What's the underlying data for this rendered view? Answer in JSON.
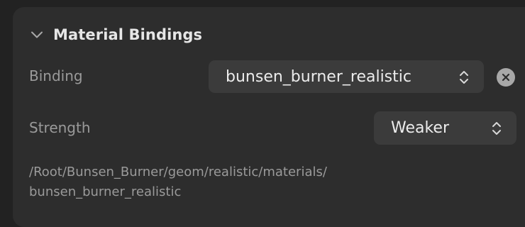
{
  "section": {
    "title": "Material Bindings",
    "expanded": true
  },
  "binding": {
    "label": "Binding",
    "value": "bunsen_burner_realistic",
    "clear_icon": "clear-x-circle-icon"
  },
  "strength": {
    "label": "Strength",
    "value": "Weaker"
  },
  "path": {
    "line1": "/Root/Bunsen_Burner/geom/realistic/materials/",
    "line2": "bunsen_burner_realistic"
  },
  "colors": {
    "panel_bg": "#2d2d2d",
    "popup_bg": "#3b3b3b",
    "label_text": "#9a9a9a",
    "value_text": "#ececec"
  }
}
